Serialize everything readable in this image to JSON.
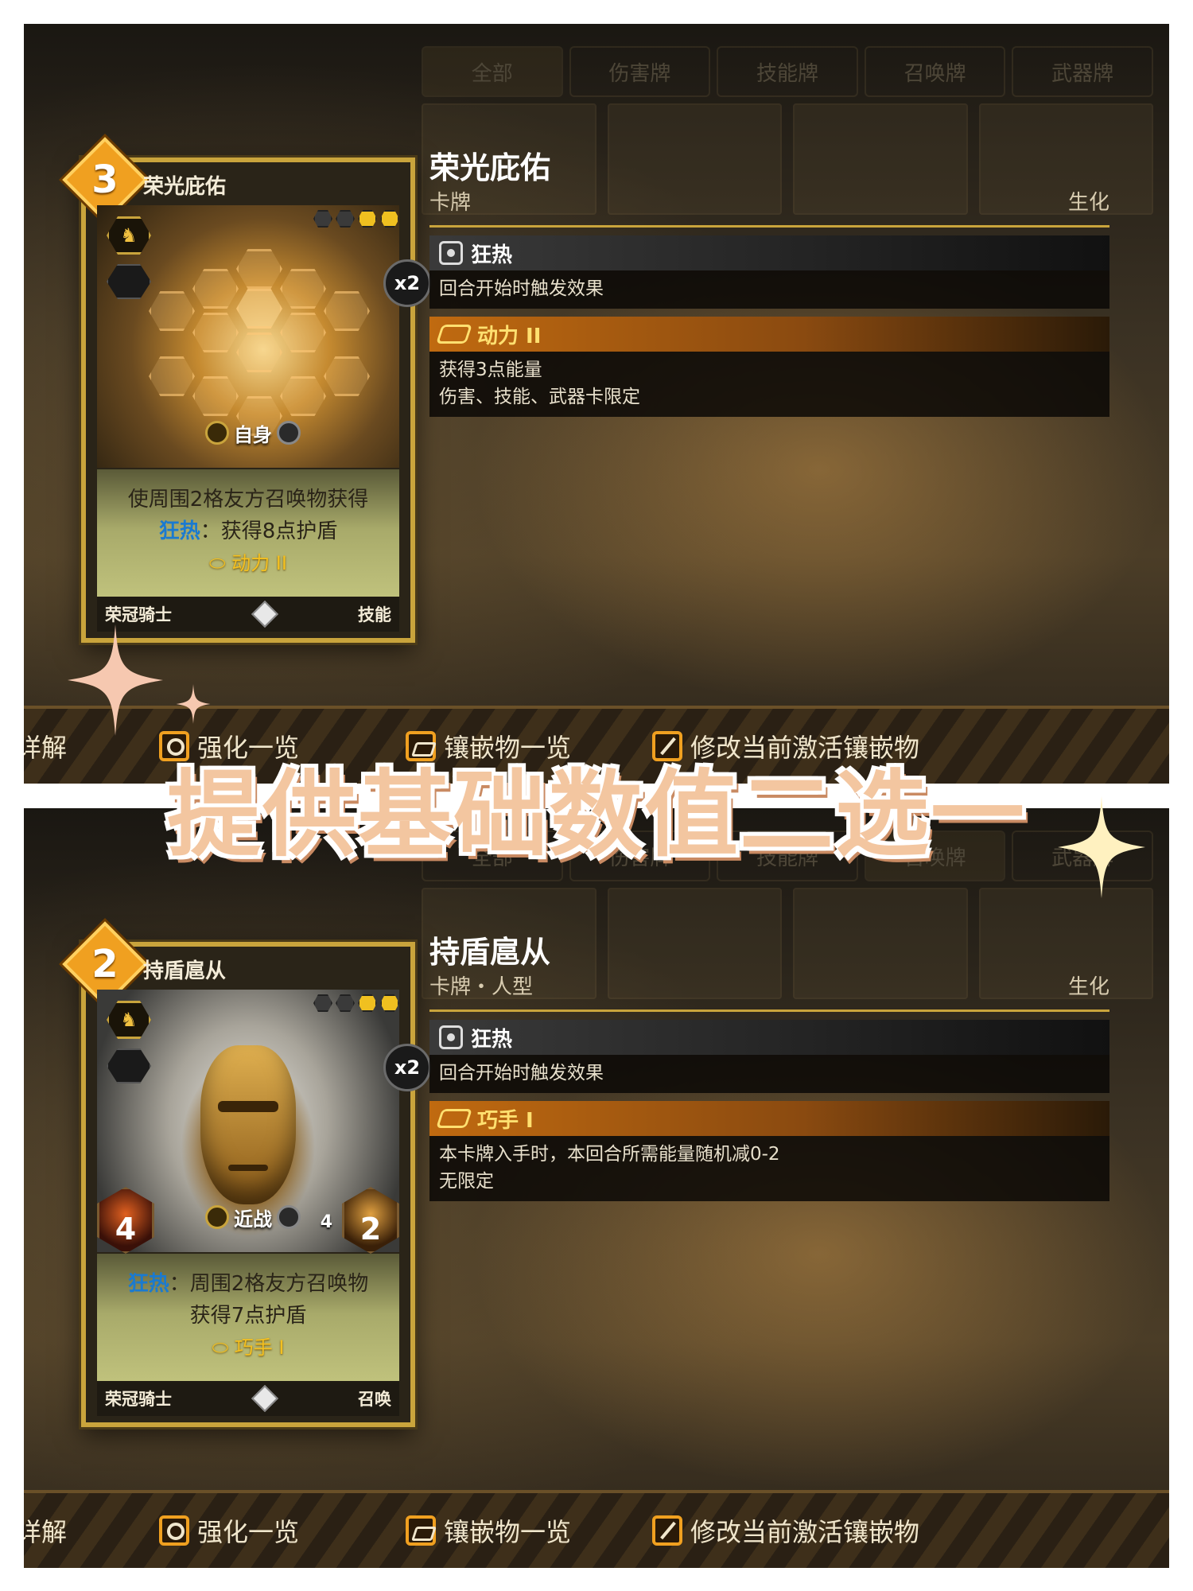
{
  "overlay": {
    "title": "提供基础数值二选一"
  },
  "tabs": [
    "全部",
    "伤害牌",
    "技能牌",
    "召唤牌",
    "武器牌"
  ],
  "bottom_bar": {
    "detail_label": "详解",
    "upgrade_label": "强化一览",
    "inlay_label": "镶嵌物一览",
    "modify_label": "修改当前激活镶嵌物"
  },
  "colors": {
    "accent_gold": "#c9a43c",
    "keyword_blue": "#1a7ad0",
    "modifier_yellow": "#f4c020",
    "title_peach": "#f3c6a0"
  },
  "panels": [
    {
      "card": {
        "cost": "3",
        "name": "荣光庇佑",
        "copies": "x2",
        "target": "自身",
        "faction_icon": "lion-crest-icon",
        "text_line1": "使周围2格友方召唤物获得",
        "keyword": "狂热",
        "text_line2_rest": "：获得8点护盾",
        "modifier": "动力 II",
        "footer_faction": "荣冠骑士",
        "footer_type": "技能"
      },
      "detail": {
        "title": "荣光庇佑",
        "subtitle": "卡牌",
        "category": "生化",
        "effects": [
          {
            "name": "狂热",
            "style": "grey",
            "icon": "mask-icon",
            "lines": [
              "回合开始时触发效果"
            ]
          },
          {
            "name": "动力 II",
            "style": "gold",
            "icon": "chip-icon",
            "lines": [
              "获得3点能量",
              "伤害、技能、武器卡限定"
            ]
          }
        ]
      }
    },
    {
      "card": {
        "cost": "2",
        "name": "持盾扈从",
        "copies": "x2",
        "target": "近战",
        "faction_icon": "lion-crest-icon",
        "attack": "4",
        "health": "2",
        "mini_stat": "4",
        "keyword": "狂热",
        "text_line1_rest": "：周围2格友方召唤物",
        "text_line2": "获得7点护盾",
        "modifier": "巧手 I",
        "footer_faction": "荣冠骑士",
        "footer_type": "召唤"
      },
      "detail": {
        "title": "持盾扈从",
        "subtitle": "卡牌・人型",
        "category": "生化",
        "effects": [
          {
            "name": "狂热",
            "style": "grey",
            "icon": "mask-icon",
            "lines": [
              "回合开始时触发效果"
            ]
          },
          {
            "name": "巧手 I",
            "style": "gold",
            "icon": "chip-icon",
            "lines": [
              "本卡牌入手时，本回合所需能量随机减0-2",
              "无限定"
            ]
          }
        ]
      }
    }
  ]
}
